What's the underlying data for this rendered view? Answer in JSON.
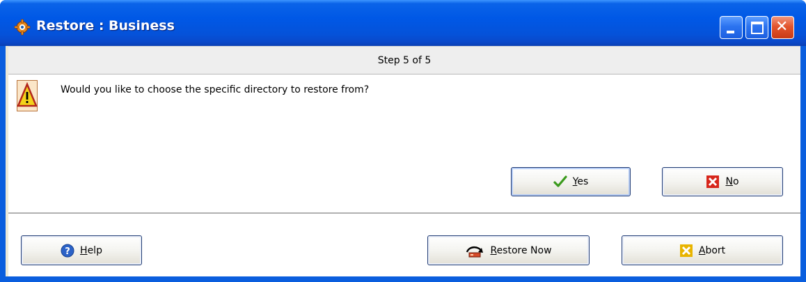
{
  "window": {
    "title": "Restore : Business",
    "title_icon": "app-gear-icon",
    "controls": {
      "minimize": "minimize-icon",
      "maximize": "maximize-icon",
      "close": "close-icon",
      "close_glyph": "✕"
    }
  },
  "step": {
    "label": "Step 5 of 5"
  },
  "message": {
    "icon": "warning-icon",
    "text": "Would you like to choose the specific directory to restore from?"
  },
  "buttons": {
    "yes": {
      "mnemonic": "Y",
      "rest": "es",
      "icon": "checkmark-icon"
    },
    "no": {
      "mnemonic": "N",
      "rest": "o",
      "icon": "x-icon"
    },
    "help": {
      "mnemonic": "H",
      "rest": "elp",
      "icon": "help-icon"
    },
    "restore_now": {
      "mnemonic": "R",
      "rest": "estore Now",
      "icon": "restore-icon"
    },
    "abort": {
      "mnemonic": "A",
      "rest": "bort",
      "icon": "abort-icon"
    }
  },
  "colors": {
    "titlebar": "#0058e6",
    "window_border": "#0a5ede",
    "yes_check": "#3a9a1c",
    "no_x": "#d7261b",
    "abort_x": "#e8b400",
    "help_circle": "#2b62c7"
  }
}
